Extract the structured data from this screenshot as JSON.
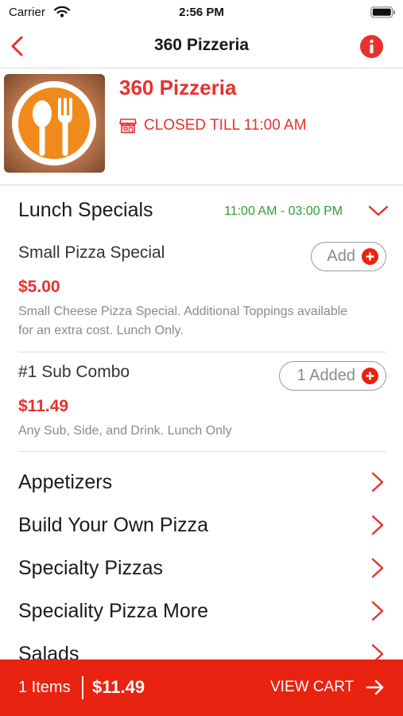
{
  "status_bar": {
    "carrier": "Carrier",
    "time": "2:56 PM"
  },
  "nav": {
    "title": "360 Pizzeria"
  },
  "restaurant": {
    "name": "360 Pizzeria",
    "status": "CLOSED TILL 11:00 AM"
  },
  "section": {
    "title": "Lunch Specials",
    "hours": "11:00 AM - 03:00 PM"
  },
  "items": [
    {
      "name": "Small Pizza Special",
      "price": "$5.00",
      "description": "Small Cheese Pizza Special. Additional Toppings available for an extra cost. Lunch Only.",
      "button_label": "Add"
    },
    {
      "name": "#1 Sub Combo",
      "price": "$11.49",
      "description": "Any Sub, Side, and Drink. Lunch Only",
      "button_label": "1 Added"
    }
  ],
  "categories": [
    {
      "label": "Appetizers"
    },
    {
      "label": "Build Your Own Pizza"
    },
    {
      "label": "Specialty Pizzas"
    },
    {
      "label": "Speciality Pizza More"
    },
    {
      "label": "Salads"
    }
  ],
  "cart": {
    "count": "1 Items",
    "total": "$11.49",
    "action": "VIEW CART"
  },
  "colors": {
    "accent": "#e8312f",
    "cart_bar": "#e8230f",
    "hours_green": "#2e9e36",
    "logo_orange": "#f08a1c"
  },
  "icons": {
    "back": "back-icon",
    "info": "info-icon",
    "store": "store-icon",
    "expand": "chevron-down-icon",
    "add": "plus-icon",
    "category": "chevron-right-icon",
    "cart": "arrow-right-icon"
  }
}
